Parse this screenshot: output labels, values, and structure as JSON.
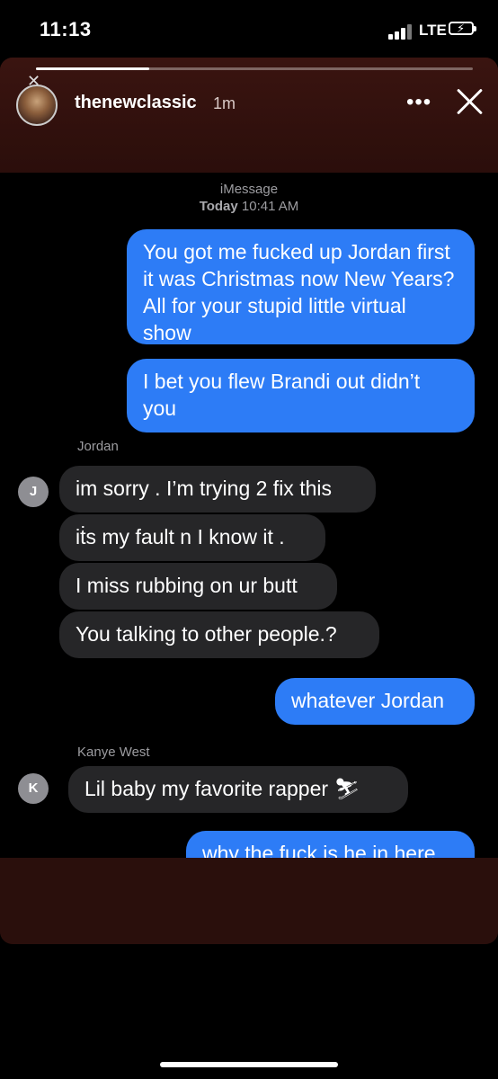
{
  "status_bar": {
    "time": "11:13",
    "network": "LTE"
  },
  "story": {
    "username": "thenewclassic",
    "time_ago": "1m",
    "more_label": "•••",
    "progress": 0.26
  },
  "thread": {
    "service": "iMessage",
    "day": "Today",
    "time": "10:41 AM",
    "messages": [
      {
        "from": "me",
        "text": "You got me fucked up Jordan first it was Christmas now New Years? All for your stupid little virtual show"
      },
      {
        "from": "me",
        "text": "I bet you flew Brandi out didn’t you"
      },
      {
        "from": "Jordan",
        "sender_label": "Jordan",
        "initial": "J",
        "text": "im sorry . I’m trying 2 fix this"
      },
      {
        "from": "Jordan",
        "text": "iṫs my fault n I know it ."
      },
      {
        "from": "Jordan",
        "text": "I miss rubbing on ur butt"
      },
      {
        "from": "Jordan",
        "text": "You talking to other people.?"
      },
      {
        "from": "me",
        "text": "whatever Jordan"
      },
      {
        "from": "Kanye West",
        "sender_label": "Kanye West",
        "initial": "K",
        "text": "Lil baby my favorite rapper",
        "emoji": "⛷"
      },
      {
        "from": "me",
        "text": "why the fuck is he in here"
      }
    ]
  }
}
